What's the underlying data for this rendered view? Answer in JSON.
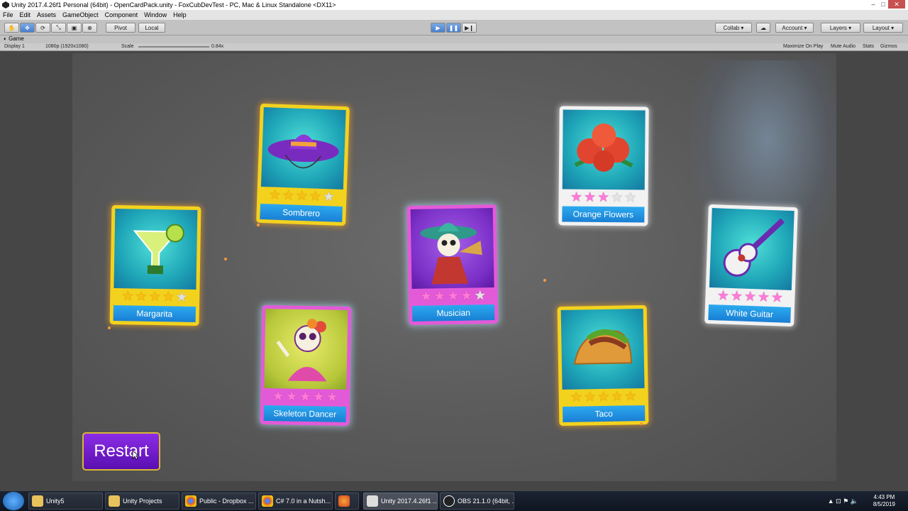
{
  "window": {
    "title": "Unity 2017.4.26f1 Personal (64bit) - OpenCardPack.unity - FoxCubDevTest - PC, Mac & Linux Standalone <DX11>",
    "controls": [
      "–",
      "□",
      "✕"
    ]
  },
  "menu": [
    "File",
    "Edit",
    "Assets",
    "GameObject",
    "Component",
    "Window",
    "Help"
  ],
  "toolbar": {
    "pivot_label": "Pivot",
    "local_label": "Local",
    "collab_label": "Collab ▾",
    "account_label": "Account",
    "layers_label": "Layers",
    "layout_label": "Layout"
  },
  "game_view": {
    "tab_label": "Game",
    "display_label": "Display 1",
    "resolution_label": "1080p (1920x1080)",
    "scale_label": "Scale",
    "scale_value": "0.84x",
    "maximize_label": "Maximize On Play",
    "mute_label": "Mute Audio",
    "stats_label": "Stats",
    "gizmos_label": "Gizmos"
  },
  "cards": [
    {
      "name": "Margarita",
      "frame": "gold",
      "stars": 4,
      "icon": "margarita-icon"
    },
    {
      "name": "Sombrero",
      "frame": "gold",
      "stars": 4,
      "icon": "sombrero-icon"
    },
    {
      "name": "Skeleton Dancer",
      "frame": "pink",
      "stars": 5,
      "icon": "skeleton-dancer-icon"
    },
    {
      "name": "Musician",
      "frame": "pink",
      "stars": 4,
      "icon": "musician-icon"
    },
    {
      "name": "Orange Flowers",
      "frame": "white",
      "stars": 3,
      "icon": "flowers-icon"
    },
    {
      "name": "Taco",
      "frame": "gold",
      "stars": 5,
      "icon": "taco-icon"
    },
    {
      "name": "White Guitar",
      "frame": "white",
      "stars": 5,
      "icon": "guitar-icon"
    }
  ],
  "restart_label": "Restart",
  "taskbar": {
    "items": [
      {
        "label": "Unity5"
      },
      {
        "label": "Unity Projects"
      },
      {
        "label": "Public - Dropbox ..."
      },
      {
        "label": "C# 7.0 in a Nutsh..."
      },
      {
        "label": ""
      },
      {
        "label": "Unity 2017.4.26f1 ..."
      },
      {
        "label": "OBS 21.1.0 (64bit, ..."
      }
    ],
    "time": "4:43 PM",
    "date": "8/5/2019"
  },
  "colors": {
    "gold_frame": "#f3d21e",
    "pink_frame": "#e35ad8",
    "white_frame": "#f2f2f2",
    "name_banner": "#1a7fd4",
    "restart_button": "#6a14c4"
  }
}
